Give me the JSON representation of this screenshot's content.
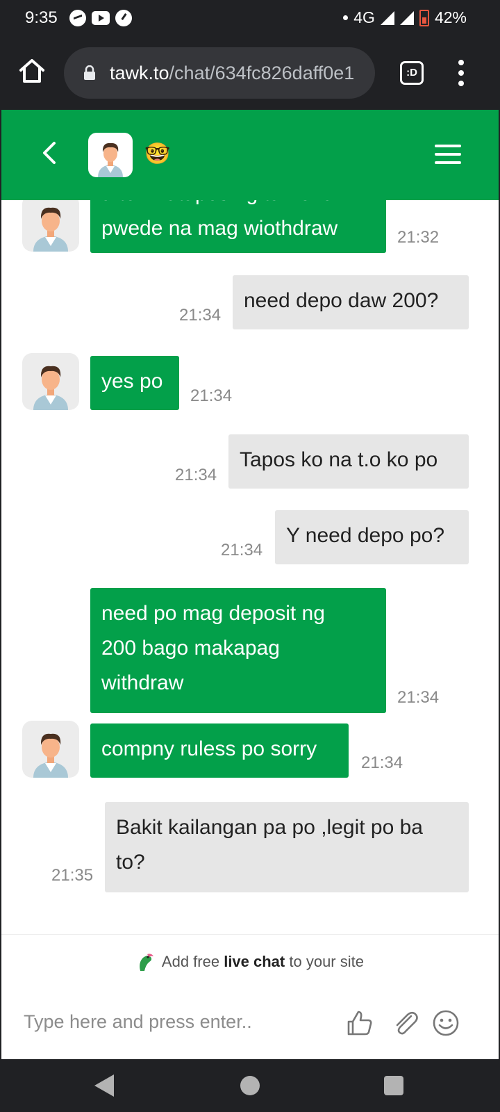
{
  "status_bar": {
    "time": "9:35",
    "network": "4G",
    "battery": "42%"
  },
  "browser": {
    "url_host": "tawk.to",
    "url_path": "/chat/634fc826daff0e1"
  },
  "chat_header": {
    "agent_emoji": "🤓"
  },
  "messages": [
    {
      "sender": "agent",
      "text_line1": "after matapos ng turnover",
      "text_line2": "pwede na mag wiothdraw",
      "time": "21:32"
    },
    {
      "sender": "visitor",
      "text": "need depo daw 200?",
      "time": "21:34"
    },
    {
      "sender": "agent",
      "text": "yes po",
      "time": "21:34"
    },
    {
      "sender": "visitor",
      "text": "Tapos ko na t.o ko po",
      "time": "21:34"
    },
    {
      "sender": "visitor",
      "text": "Y need depo po?",
      "time": "21:34"
    },
    {
      "sender": "agent",
      "lines": [
        "need po mag deposit ng",
        "200 bago makapag",
        "withdraw"
      ],
      "time": "21:34"
    },
    {
      "sender": "agent",
      "text": "compny ruless po sorry",
      "time": "21:34"
    },
    {
      "sender": "visitor",
      "lines": [
        "Bakit kailangan pa po ,legit po ba",
        "to?"
      ],
      "time": "21:35"
    }
  ],
  "branding": {
    "prefix": "Add free",
    "highlight": "live chat",
    "suffix": "to your site"
  },
  "input": {
    "placeholder": "Type here and press enter.."
  },
  "colors": {
    "brand_green": "#03a04a",
    "visitor_bubble": "#e6e6e6",
    "chrome_dark": "#202124"
  },
  "icons": [
    "messenger-icon",
    "youtube-icon",
    "gauge-icon",
    "home-icon",
    "lock-icon",
    "extension-icon",
    "more-icon",
    "back-icon",
    "menu-icon",
    "parrot-icon",
    "thumbs-up-icon",
    "paperclip-icon",
    "emoji-icon"
  ]
}
